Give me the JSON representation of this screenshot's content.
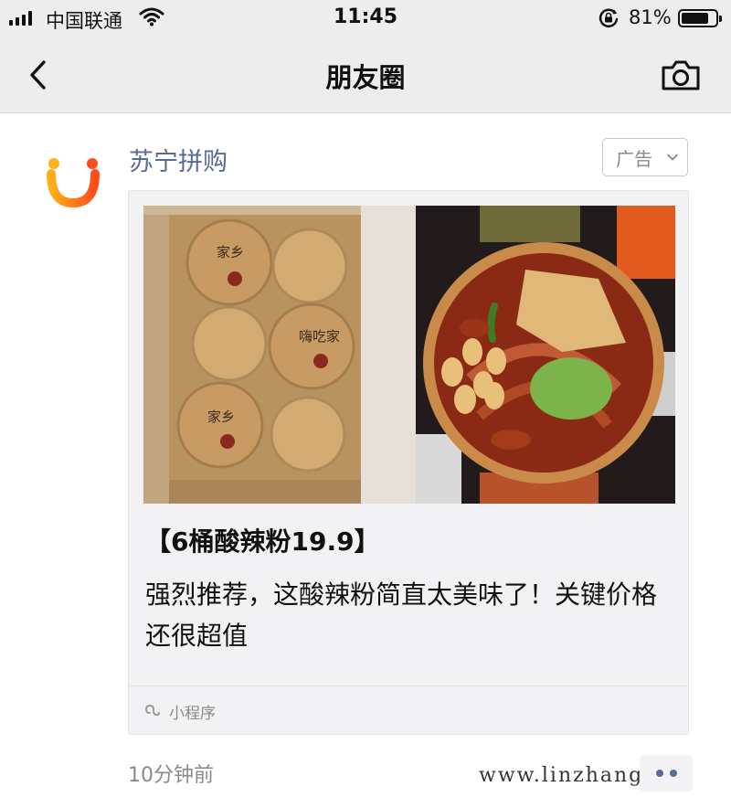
{
  "status_bar": {
    "carrier": "中国联通",
    "time": "11:45",
    "battery_percent": "81%",
    "battery_level": 0.81,
    "icons": [
      "signal-icon",
      "wifi-icon",
      "orientation-lock-icon",
      "battery-icon"
    ]
  },
  "nav": {
    "title": "朋友圈",
    "back_icon": "chevron-left-icon",
    "camera_icon": "camera-icon"
  },
  "post": {
    "account_name": "苏宁拼购",
    "ad_label": "广告",
    "card": {
      "title": "【6桶酸辣粉19.9】",
      "description": "强烈推荐，这酸辣粉简直太美味了！关键价格还很超值",
      "footer_label": "小程序"
    },
    "timestamp": "10分钟前"
  },
  "watermark": "www.linzhang.cc",
  "colors": {
    "link_blue": "#576b95",
    "bar_gray": "#ededed",
    "card_bg": "#f2f2f4"
  }
}
